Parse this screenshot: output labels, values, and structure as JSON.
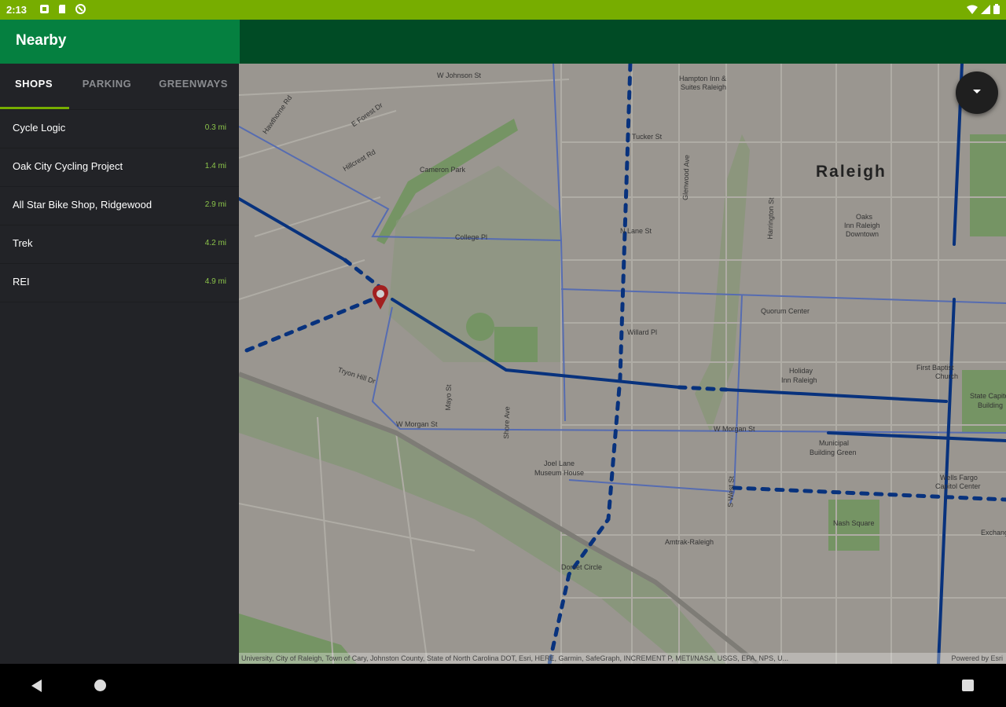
{
  "status_bar": {
    "time": "2:13",
    "left_icons": [
      "notification-icon",
      "sd-card-icon",
      "sync-icon"
    ],
    "right_icons": [
      "wifi-icon",
      "signal-icon",
      "battery-icon"
    ]
  },
  "app_bar": {
    "title": "Nearby"
  },
  "tabs": [
    {
      "label": "SHOPS",
      "active": true
    },
    {
      "label": "PARKING",
      "active": false
    },
    {
      "label": "GREENWAYS",
      "active": false
    }
  ],
  "shops": [
    {
      "name": "Cycle Logic",
      "distance": "0.3 mi"
    },
    {
      "name": "Oak City Cycling Project",
      "distance": "1.4 mi"
    },
    {
      "name": "All Star Bike Shop, Ridgewood",
      "distance": "2.9 mi"
    },
    {
      "name": "Trek",
      "distance": "4.2 mi"
    },
    {
      "name": "REI",
      "distance": "4.9 mi"
    }
  ],
  "map": {
    "city": "Raleigh",
    "labels": {
      "w_johnson_st": "W Johnson St",
      "hampton_inn": "Hampton Inn &",
      "hampton_inn2": "Suites Raleigh",
      "hawthorne_rd": "Hawthorne Rd",
      "e_forest_dr": "E Forest Dr",
      "hillcrest_rd": "Hillcrest Rd",
      "tucker_st": "Tucker St",
      "cameron_park": "Cameron Park",
      "glenwood_ave": "Glenwood Ave",
      "college_pl": "College Pl",
      "n_lane_st": "N Lane St",
      "harrington_st": "Harrington St",
      "doubletree": "Oaks",
      "doubletree2": "Inn Raleigh",
      "doubletree3": "Downtown",
      "quorum_center": "Quorum Center",
      "willard_pl": "Willard Pl",
      "tryon_hill_dr": "Tryon Hill Dr",
      "holiday_inn": "Holiday",
      "holiday_inn2": "Inn Raleigh",
      "first_baptist": "First Baptist",
      "first_baptist2": "Church",
      "state_capitol": "State Capitol",
      "state_capitol2": "Building",
      "w_morgan_st": "W Morgan St",
      "municipal": "Municipal",
      "municipal2": "Building Green",
      "joel_lane": "Joel Lane",
      "joel_lane2": "Museum House",
      "wells_fargo": "Wells Fargo",
      "wells_fargo2": "Capitol Center",
      "nash_square": "Nash Square",
      "amtrak": "Amtrak-Raleigh",
      "exchange": "Exchange",
      "boylan_circle": "Dorset Circle",
      "mayo_st": "Mayo St",
      "shore_ave": "Shore Ave",
      "s_west_st": "S West St"
    },
    "attribution": "University, City of Raleigh, Town of Cary, Johnston County, State of North Carolina DOT, Esri, HERE, Garmin, SafeGraph, INCREMENT P, METI/NASA, USGS, EPA, NPS, U...",
    "powered_by": "Powered by Esri",
    "colors": {
      "route_solid": "#0a3e99",
      "route_dashed": "#0a3e99",
      "route_thin": "#6a84d8",
      "park": "#8fb57a",
      "pin": "#c62828"
    }
  },
  "colors": {
    "status_bar": "#77ad00",
    "app_bar": "#004b25",
    "app_bar_left": "#058040",
    "sidebar": "#222327",
    "accent": "#8bc34a"
  }
}
